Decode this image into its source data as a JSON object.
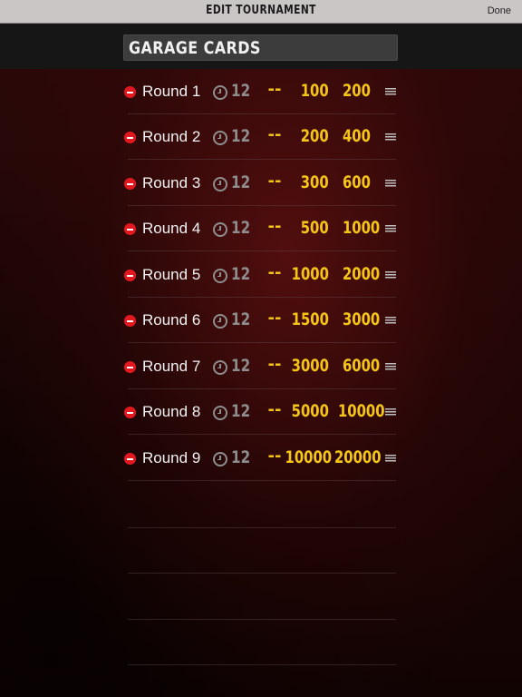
{
  "navbar": {
    "title": "EDIT TOURNAMENT",
    "done_label": "Done"
  },
  "tournament": {
    "name": "GARAGE CARDS"
  },
  "rounds": [
    {
      "label": "Round 1",
      "duration": "12",
      "ante": "--",
      "small_blind": "100",
      "big_blind": "200"
    },
    {
      "label": "Round 2",
      "duration": "12",
      "ante": "--",
      "small_blind": "200",
      "big_blind": "400"
    },
    {
      "label": "Round 3",
      "duration": "12",
      "ante": "--",
      "small_blind": "300",
      "big_blind": "600"
    },
    {
      "label": "Round 4",
      "duration": "12",
      "ante": "--",
      "small_blind": "500",
      "big_blind": "1000"
    },
    {
      "label": "Round 5",
      "duration": "12",
      "ante": "--",
      "small_blind": "1000",
      "big_blind": "2000"
    },
    {
      "label": "Round 6",
      "duration": "12",
      "ante": "--",
      "small_blind": "1500",
      "big_blind": "3000"
    },
    {
      "label": "Round 7",
      "duration": "12",
      "ante": "--",
      "small_blind": "3000",
      "big_blind": "6000"
    },
    {
      "label": "Round 8",
      "duration": "12",
      "ante": "--",
      "small_blind": "5000",
      "big_blind": "10000"
    },
    {
      "label": "Round 9",
      "duration": "12",
      "ante": "--",
      "small_blind": "10000",
      "big_blind": "20000"
    }
  ],
  "icons": {
    "delete": "minus-circle-icon",
    "duration": "clock-icon",
    "reorder": "reorder-grip-icon"
  },
  "colors": {
    "blind_text": "#f5c518",
    "delete_red": "#e3181f",
    "navbar_bg": "#cbc6c6"
  }
}
